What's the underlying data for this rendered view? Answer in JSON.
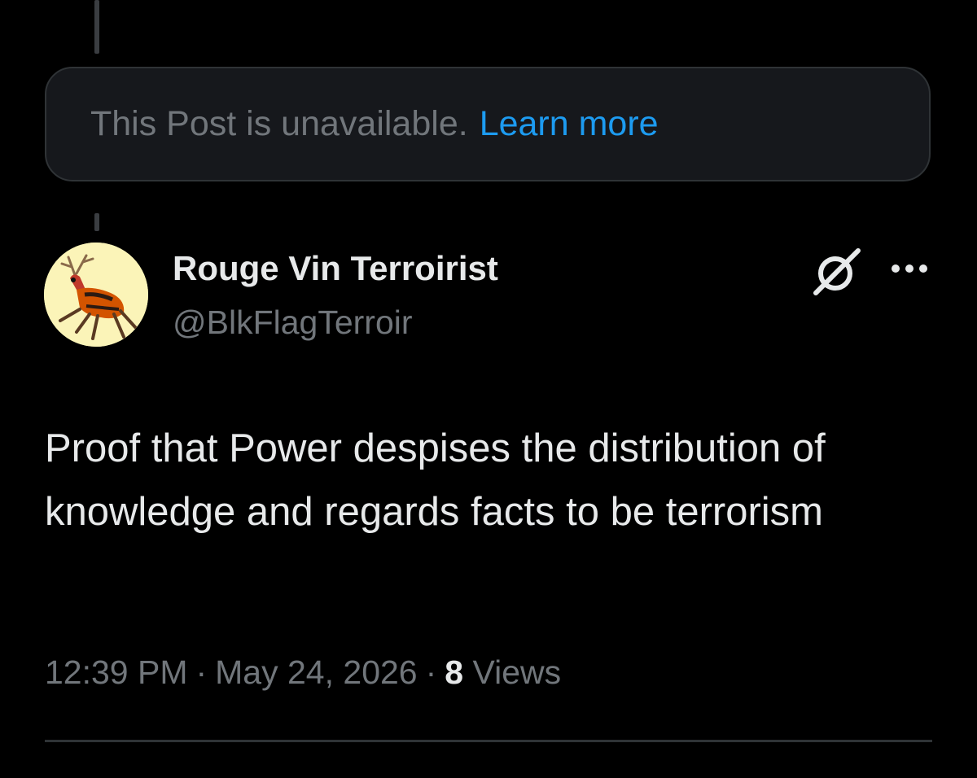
{
  "unavailable": {
    "message": "This Post is unavailable.",
    "link": "Learn more"
  },
  "post": {
    "display_name": "Rouge Vin Terroirist",
    "handle": "@BlkFlagTerroir",
    "text": "Proof that Power despises the distribution of knowledge and regards facts to be terrorism",
    "time": "12:39 PM",
    "separator": "·",
    "date": "May 24, 2026",
    "views_count": "8",
    "views_label": "Views"
  },
  "colors": {
    "background": "#000000",
    "text_primary": "#e7e9ea",
    "text_secondary": "#71767b",
    "link": "#1d9bf0",
    "border": "#2f3336",
    "avatar_bg": "#fbf4b8"
  },
  "icons": {
    "grok": "grok-icon",
    "more": "more-options-icon"
  }
}
